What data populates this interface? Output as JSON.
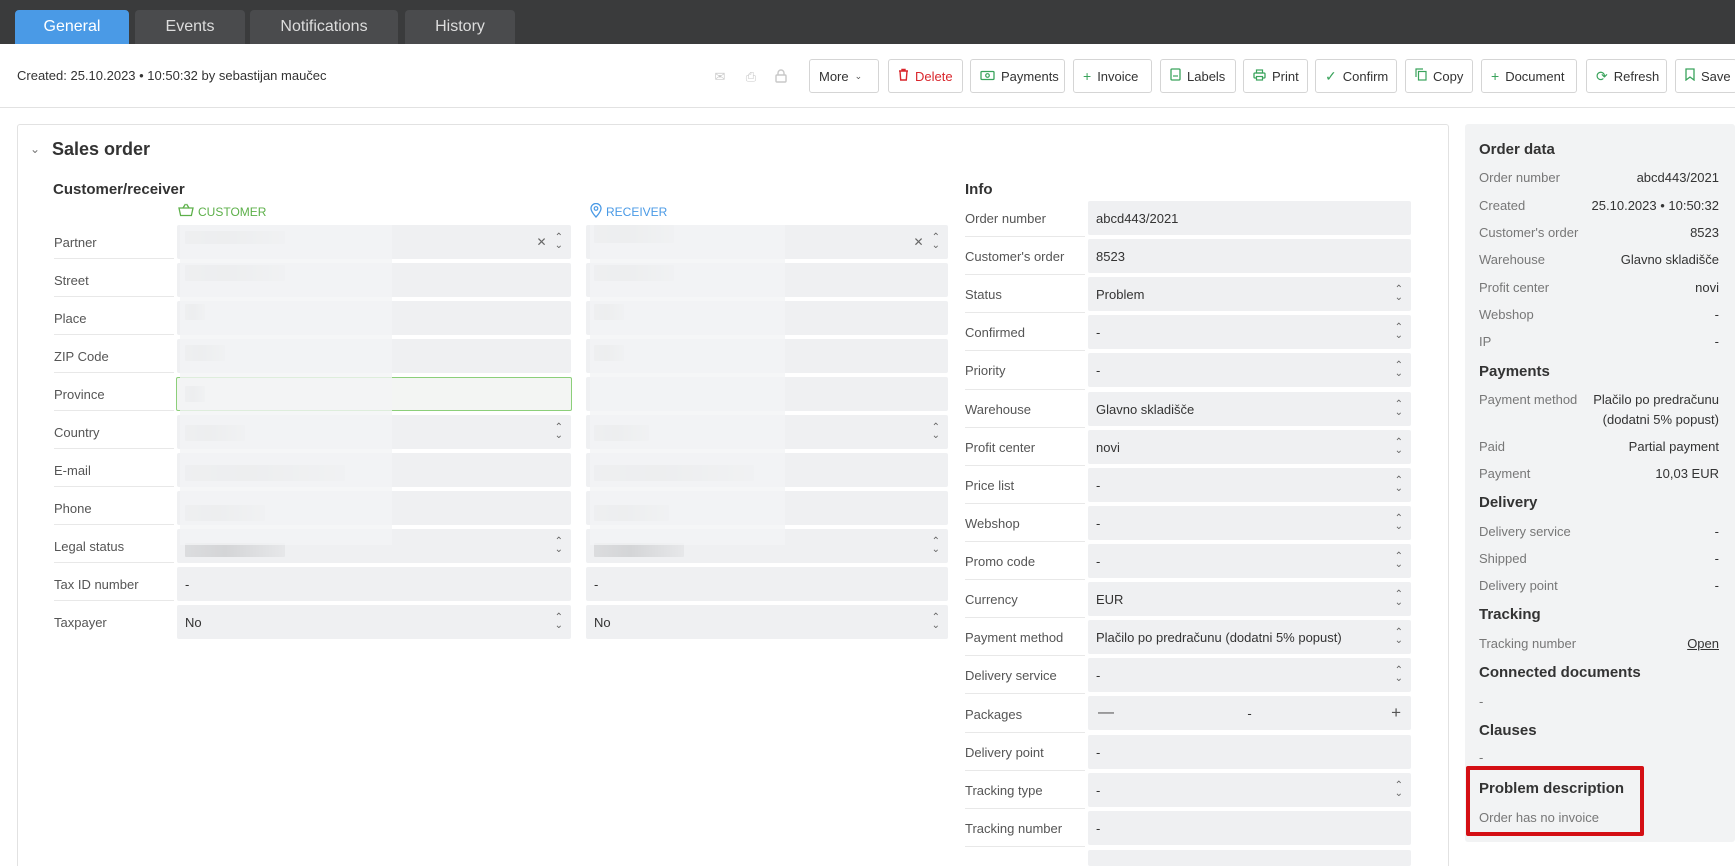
{
  "tabs": [
    "General",
    "Events",
    "Notifications",
    "History"
  ],
  "created_text": "Created: 25.10.2023 • 10:50:32 by sebastijan maučec",
  "actions": {
    "more": "More",
    "delete": "Delete",
    "payments": "Payments",
    "invoice": "Invoice",
    "labels": "Labels",
    "print": "Print",
    "confirm": "Confirm",
    "copy": "Copy",
    "document": "Document",
    "refresh": "Refresh",
    "save": "Save"
  },
  "sales_order": {
    "title": "Sales order",
    "customer_receiver_title": "Customer/receiver",
    "customer_head": "CUSTOMER",
    "receiver_head": "RECEIVER",
    "fields": [
      "Partner",
      "Street",
      "Place",
      "ZIP Code",
      "Province",
      "Country",
      "E-mail",
      "Phone",
      "Legal status",
      "Tax ID number",
      "Taxpayer"
    ],
    "tax_id_customer": "-",
    "tax_id_receiver": "-",
    "taxpayer_customer": "No",
    "taxpayer_receiver": "No"
  },
  "info": {
    "title": "Info",
    "rows": [
      {
        "label": "Order number",
        "value": "abcd443/2021"
      },
      {
        "label": "Customer's order",
        "value": "8523"
      },
      {
        "label": "Status",
        "value": "Problem"
      },
      {
        "label": "Confirmed",
        "value": "-"
      },
      {
        "label": "Priority",
        "value": "-"
      },
      {
        "label": "Warehouse",
        "value": "Glavno skladišče"
      },
      {
        "label": "Profit center",
        "value": "novi"
      },
      {
        "label": "Price list",
        "value": "-"
      },
      {
        "label": "Webshop",
        "value": "-"
      },
      {
        "label": "Promo code",
        "value": "-"
      },
      {
        "label": "Currency",
        "value": "EUR"
      },
      {
        "label": "Payment method",
        "value": "Plačilo po predračunu (dodatni 5% popust)"
      },
      {
        "label": "Delivery service",
        "value": "-"
      },
      {
        "label": "Packages",
        "value": "-"
      },
      {
        "label": "Delivery point",
        "value": "-"
      },
      {
        "label": "Tracking type",
        "value": "-"
      },
      {
        "label": "Tracking number",
        "value": "-"
      }
    ]
  },
  "order_data": {
    "title": "Order data",
    "rows": [
      {
        "label": "Order number",
        "value": "abcd443/2021"
      },
      {
        "label": "Created",
        "value": "25.10.2023 • 10:50:32"
      },
      {
        "label": "Customer's order",
        "value": "8523"
      },
      {
        "label": "Warehouse",
        "value": "Glavno skladišče"
      },
      {
        "label": "Profit center",
        "value": "novi"
      },
      {
        "label": "Webshop",
        "value": "-"
      },
      {
        "label": "IP",
        "value": "-"
      }
    ]
  },
  "payments": {
    "title": "Payments",
    "method_label": "Payment method",
    "method_value_1": "Plačilo po predračunu",
    "method_value_2": "(dodatni 5% popust)",
    "paid_label": "Paid",
    "paid_value": "Partial payment",
    "payment_label": "Payment",
    "payment_value": "10,03 EUR"
  },
  "delivery": {
    "title": "Delivery",
    "rows": [
      {
        "label": "Delivery service",
        "value": "-"
      },
      {
        "label": "Shipped",
        "value": "-"
      },
      {
        "label": "Delivery point",
        "value": "-"
      }
    ]
  },
  "tracking": {
    "title": "Tracking",
    "number_label": "Tracking number",
    "open_link": "Open"
  },
  "connected": {
    "title": "Connected documents",
    "value": "-"
  },
  "clauses": {
    "title": "Clauses",
    "value": "-"
  },
  "problem": {
    "title": "Problem description",
    "text": "Order has no invoice"
  },
  "colors": {
    "accent": "#4a9ae6",
    "customer": "#5db04a",
    "danger": "#d40f14",
    "action_icon": "#3aa35c"
  }
}
